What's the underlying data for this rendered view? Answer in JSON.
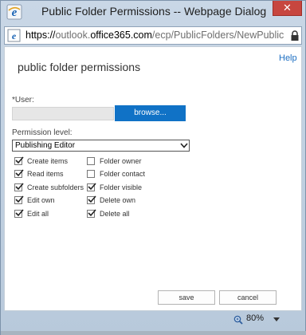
{
  "window": {
    "title": "Public Folder Permissions -- Webpage Dialog",
    "close_label": "✕",
    "title_icon": "ie-icon",
    "close_color": "#c7463f"
  },
  "address": {
    "scheme": "https://",
    "pre_host": "outlook.",
    "host": "office365.com",
    "path": "/ecp/PublicFolders/NewPublicFolder",
    "site_icon": "ie-page-icon",
    "lock_icon": "lock-icon"
  },
  "page": {
    "help": "Help",
    "title": "public folder permissions",
    "user_label": "*User:",
    "user_value": "",
    "browse_label": "browse...",
    "permission_label": "Permission level:",
    "permission_value": "Publishing Editor",
    "checkboxes_left": [
      {
        "label": "Create items",
        "checked": true
      },
      {
        "label": "Read items",
        "checked": true
      },
      {
        "label": "Create subfolders",
        "checked": true
      },
      {
        "label": "Edit own",
        "checked": true
      },
      {
        "label": "Edit all",
        "checked": true
      }
    ],
    "checkboxes_right": [
      {
        "label": "Folder owner",
        "checked": false
      },
      {
        "label": "Folder contact",
        "checked": false
      },
      {
        "label": "Folder visible",
        "checked": true
      },
      {
        "label": "Delete own",
        "checked": true
      },
      {
        "label": "Delete all",
        "checked": true
      }
    ],
    "save_label": "save",
    "cancel_label": "cancel",
    "accent_color": "#1072c6",
    "link_color": "#1c6ec2"
  },
  "status": {
    "zoom": "80%",
    "zoom_icon": "magnifier-icon"
  }
}
